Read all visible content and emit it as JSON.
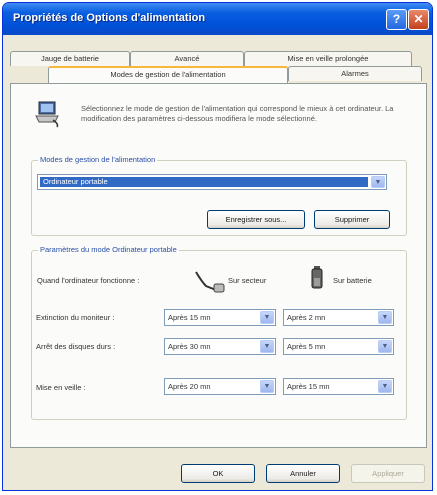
{
  "window": {
    "title": "Propriétés de Options d'alimentation"
  },
  "tabs_back": [
    "Jauge de batterie",
    "Avancé",
    "Mise en veille prolongée"
  ],
  "tabs_front": [
    "Modes de gestion de l'alimentation",
    "Alarmes"
  ],
  "description": "Sélectionnez le mode de gestion de l'alimentation qui correspond le mieux à cet ordinateur. La modification des paramètres ci-dessous modifiera le mode sélectionné.",
  "scheme_group": {
    "legend": "Modes de gestion de l'alimentation",
    "selected": "Ordinateur portable",
    "save_label": "Enregistrer sous...",
    "delete_label": "Supprimer"
  },
  "settings_group": {
    "legend": "Paramètres du mode Ordinateur portable",
    "when_label": "Quand l'ordinateur fonctionne :",
    "ac_label": "Sur secteur",
    "battery_label": "Sur batterie",
    "rows": [
      {
        "label": "Extinction du moniteur :",
        "ac": "Après 15 mn",
        "dc": "Après 2 mn"
      },
      {
        "label": "Arrêt des disques durs :",
        "ac": "Après 30 mn",
        "dc": "Après 5 mn"
      },
      {
        "label": "Mise en veille :",
        "ac": "Après 20 mn",
        "dc": "Après 15 mn"
      }
    ]
  },
  "footer": {
    "ok_label": "OK",
    "cancel_label": "Annuler",
    "apply_label": "Appliquer"
  }
}
